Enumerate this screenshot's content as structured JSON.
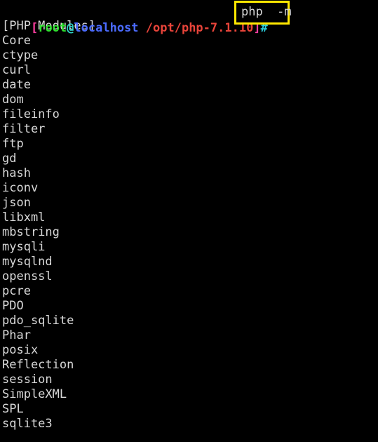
{
  "terminal": {
    "background_color": "#000000",
    "foreground_color": "#d8d8d8",
    "prompt": {
      "open_bracket": "[",
      "user": "root",
      "at": "@",
      "host": "localhost",
      "separator": " ",
      "path": "/opt/php-7.1.10",
      "close_bracket": "]",
      "sigil": "#",
      "colors": {
        "bracket": "#ff3fa0",
        "user": "#2ee12e",
        "at": "#2fd5c8",
        "host": "#4b6bff",
        "path": "#e8443a",
        "sigil": "#29d0e0"
      }
    },
    "command": {
      "text": "php  -m",
      "highlight_border_color": "#ffe800",
      "text_color": "#d8d8d8"
    },
    "output": {
      "header": "[PHP Modules]",
      "modules": [
        "Core",
        "ctype",
        "curl",
        "date",
        "dom",
        "fileinfo",
        "filter",
        "ftp",
        "gd",
        "hash",
        "iconv",
        "json",
        "libxml",
        "mbstring",
        "mysqli",
        "mysqlnd",
        "openssl",
        "pcre",
        "PDO",
        "pdo_sqlite",
        "Phar",
        "posix",
        "Reflection",
        "session",
        "SimpleXML",
        "SPL",
        "sqlite3"
      ]
    }
  }
}
